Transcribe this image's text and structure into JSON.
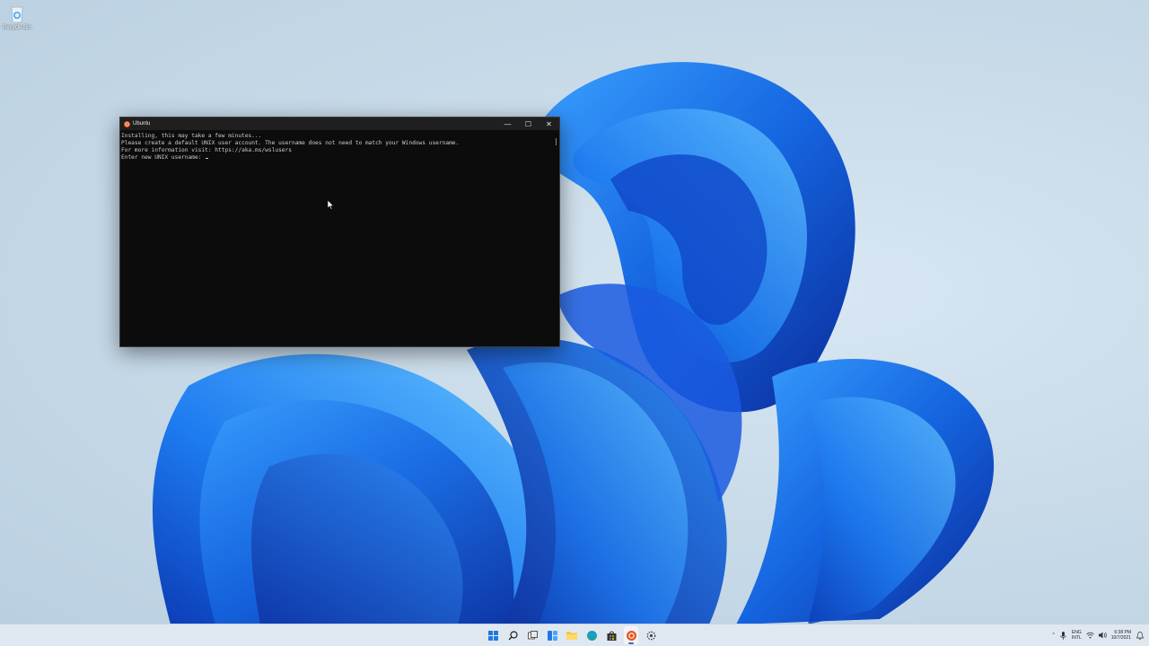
{
  "desktop": {
    "recycle_bin_label": "Recycle Bin"
  },
  "window": {
    "title": "Ubuntu",
    "icon": "ubuntu-icon",
    "controls": {
      "minimize": "—",
      "maximize": "☐",
      "close": "✕"
    },
    "terminal_lines": [
      "Installing, this may take a few minutes...",
      "Please create a default UNIX user account. The username does not need to match your Windows username.",
      "For more information visit: https://aka.ms/wslusers",
      "Enter new UNIX username: "
    ]
  },
  "taskbar": {
    "apps": [
      {
        "name": "start-button",
        "icon": "windows-logo-icon",
        "active": false
      },
      {
        "name": "search-button",
        "icon": "search-icon",
        "active": false
      },
      {
        "name": "task-view-button",
        "icon": "task-view-icon",
        "active": false
      },
      {
        "name": "widgets-button",
        "icon": "widgets-icon",
        "active": false
      },
      {
        "name": "file-explorer-button",
        "icon": "folder-icon",
        "active": false
      },
      {
        "name": "edge-button",
        "icon": "edge-icon",
        "active": false
      },
      {
        "name": "store-button",
        "icon": "store-icon",
        "active": false
      },
      {
        "name": "ubuntu-taskbar-button",
        "icon": "ubuntu-icon",
        "active": true
      },
      {
        "name": "settings-button",
        "icon": "gear-icon",
        "active": false
      }
    ],
    "tray": {
      "chevron": "^",
      "lang_line1": "ENG",
      "lang_line2": "INTL",
      "time": "6:38 PM",
      "date": "10/7/2021"
    }
  },
  "colors": {
    "accent": "#2a73c9",
    "terminal_bg": "#0c0c0c",
    "terminal_text": "#cccccc",
    "ubuntu_orange": "#e95420"
  }
}
